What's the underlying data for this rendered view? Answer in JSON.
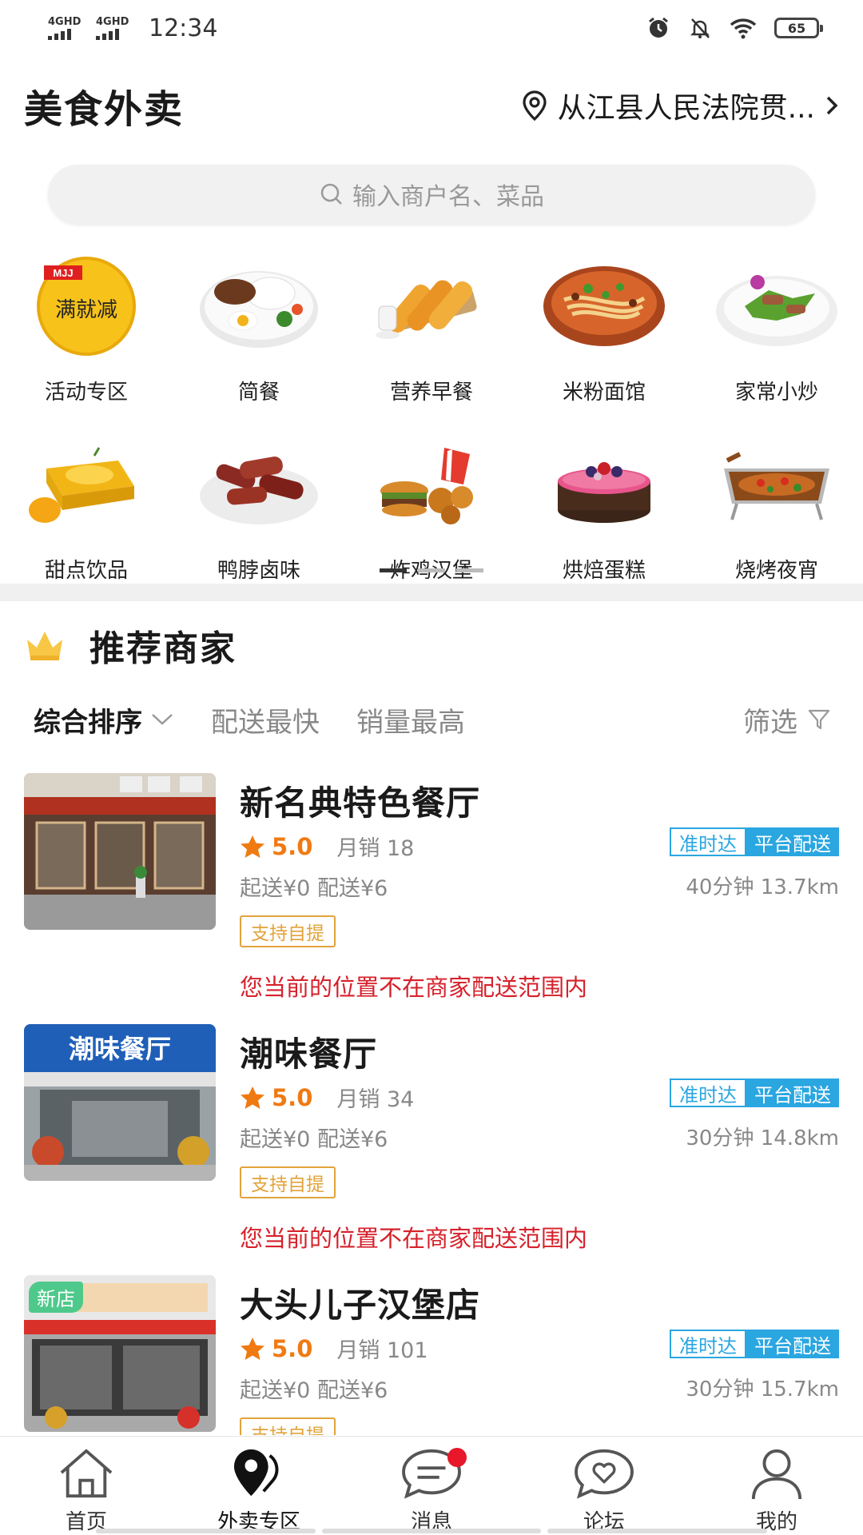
{
  "status_bar": {
    "signal1": "4GHD",
    "signal2": "4GHD",
    "time": "12:34",
    "battery": "65",
    "icons": [
      "alarm-icon",
      "bell-off-icon",
      "wifi-icon",
      "battery-icon"
    ]
  },
  "header": {
    "title": "美食外卖",
    "location": "从江县人民法院贯..."
  },
  "search": {
    "placeholder": "输入商户名、菜品"
  },
  "categories": [
    {
      "label": "活动专区",
      "image": "full-reduction-badge"
    },
    {
      "label": "简餐",
      "image": "rice-plate"
    },
    {
      "label": "营养早餐",
      "image": "fried-dough-sticks"
    },
    {
      "label": "米粉面馆",
      "image": "noodle-bowl"
    },
    {
      "label": "家常小炒",
      "image": "stir-fry-plate"
    },
    {
      "label": "甜点饮品",
      "image": "mango-dessert"
    },
    {
      "label": "鸭脖卤味",
      "image": "braised-duck-neck"
    },
    {
      "label": "炸鸡汉堡",
      "image": "fried-chicken-burger"
    },
    {
      "label": "烘焙蛋糕",
      "image": "cake"
    },
    {
      "label": "烧烤夜宵",
      "image": "grilled-fish"
    }
  ],
  "activity_badge": {
    "brand": "MJJ",
    "text": "满就减"
  },
  "pager": {
    "pages": 3,
    "current": 1
  },
  "recommend": {
    "title": "推荐商家"
  },
  "sort": {
    "items": [
      "综合排序",
      "配送最快",
      "销量最高"
    ],
    "filter": "筛选"
  },
  "merchants": [
    {
      "name": "新名典特色餐厅",
      "score": "5.0",
      "sales": "月销 18",
      "fees": "起送¥0  配送¥6",
      "tag_ontime": "准时达",
      "tag_platform": "平台配送",
      "eta": "40分钟 13.7km",
      "pickup": "支持自提",
      "warning": "您当前的位置不在商家配送范围内",
      "new_badge": ""
    },
    {
      "name": "潮味餐厅",
      "score": "5.0",
      "sales": "月销 34",
      "fees": "起送¥0  配送¥6",
      "tag_ontime": "准时达",
      "tag_platform": "平台配送",
      "eta": "30分钟 14.8km",
      "pickup": "支持自提",
      "warning": "您当前的位置不在商家配送范围内",
      "new_badge": "",
      "sign": "潮味餐厅"
    },
    {
      "name": "大头儿子汉堡店",
      "score": "5.0",
      "sales": "月销 101",
      "fees": "起送¥0  配送¥6",
      "tag_ontime": "准时达",
      "tag_platform": "平台配送",
      "eta": "30分钟 15.7km",
      "pickup": "支持自提",
      "warning": "",
      "new_badge": "新店"
    }
  ],
  "bottom_nav": [
    {
      "label": "首页",
      "icon": "home-icon"
    },
    {
      "label": "外卖专区",
      "icon": "location-pin-icon"
    },
    {
      "label": "消息",
      "icon": "message-icon"
    },
    {
      "label": "论坛",
      "icon": "forum-heart-icon"
    },
    {
      "label": "我的",
      "icon": "user-icon"
    }
  ],
  "colors": {
    "accent_orange": "#f07a12",
    "tag_blue": "#2aa6e0",
    "warning_red": "#d6212b",
    "pickup_gold": "#e2a33a",
    "new_green": "#4fc98b",
    "notify_dot": "#e8172a"
  }
}
